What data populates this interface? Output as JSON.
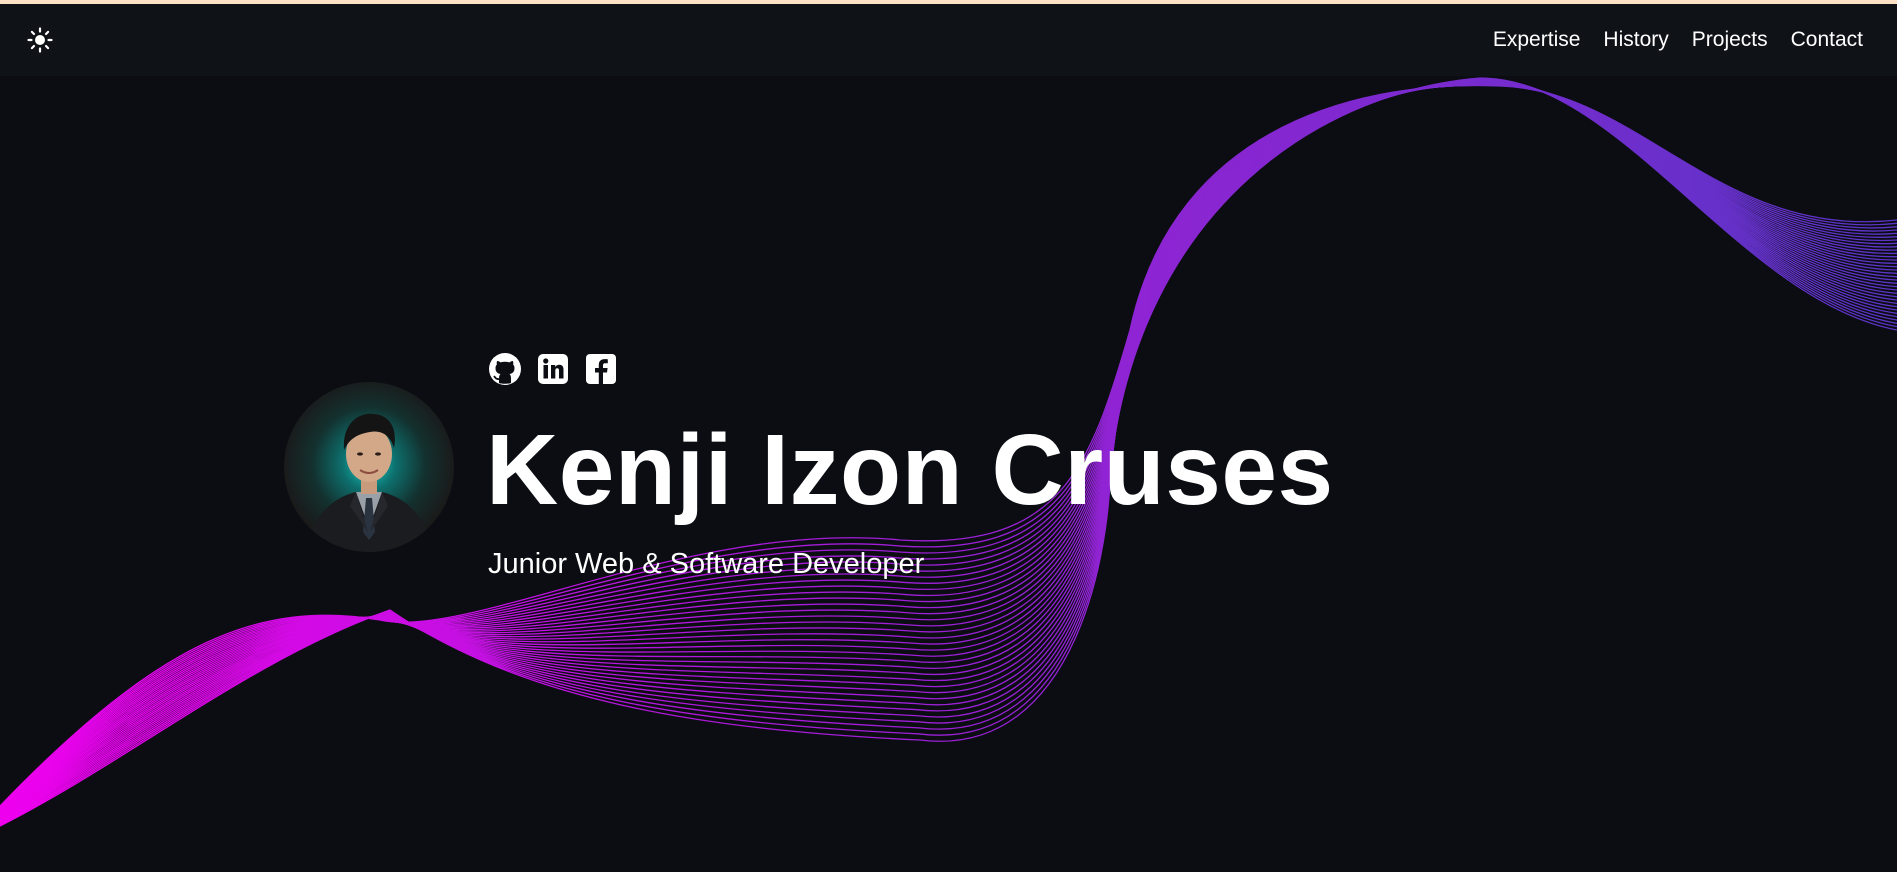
{
  "theme": {
    "accent_bar": "#fde2c5",
    "background": "#0b0d12",
    "navbar_background": "#0f1217",
    "wave_colors": [
      "#ee00ee",
      "#9b20d6",
      "#5b34c8"
    ]
  },
  "navbar": {
    "theme_toggle_icon": "sun-icon",
    "links": [
      {
        "label": "Expertise"
      },
      {
        "label": "History"
      },
      {
        "label": "Projects"
      },
      {
        "label": "Contact"
      }
    ]
  },
  "hero": {
    "avatar_icon": "profile-photo",
    "social": [
      {
        "icon": "github-icon"
      },
      {
        "icon": "linkedin-icon"
      },
      {
        "icon": "facebook-icon"
      }
    ],
    "name": "Kenji Izon Cruses",
    "title": "Junior Web & Software Developer"
  }
}
